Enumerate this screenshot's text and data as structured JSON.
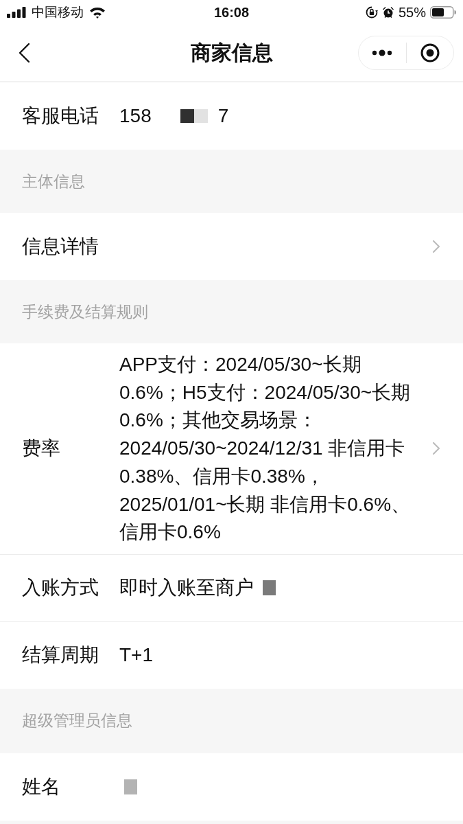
{
  "status_bar": {
    "carrier": "中国移动",
    "time": "16:08",
    "battery": "55%"
  },
  "nav": {
    "title": "商家信息"
  },
  "sections": [
    {
      "rows": [
        {
          "label": "客服电话",
          "value": "158",
          "masked": true,
          "value_tail": "7",
          "chevron": false
        }
      ]
    },
    {
      "header": "主体信息",
      "rows": [
        {
          "label": "信息详情",
          "masked": false,
          "chevron": true
        }
      ]
    },
    {
      "header": "手续费及结算规则",
      "rows": [
        {
          "label": "费率",
          "value": "APP支付：2024/05/30~长期0.6%；H5支付：2024/05/30~长期0.6%；其他交易场景：2024/05/30~2024/12/31 非信用卡0.38%、信用卡0.38%，2025/01/01~长期 非信用卡0.6%、信用卡0.6%",
          "masked": false,
          "chevron": true
        },
        {
          "label": "入账方式",
          "value": "即时入账至商户",
          "masked": true,
          "chevron": false
        },
        {
          "label": "结算周期",
          "value": "T+1",
          "masked": false,
          "chevron": false
        }
      ]
    },
    {
      "header": "超级管理员信息",
      "rows": [
        {
          "label": "姓名",
          "masked": true,
          "chevron": false
        }
      ]
    }
  ]
}
